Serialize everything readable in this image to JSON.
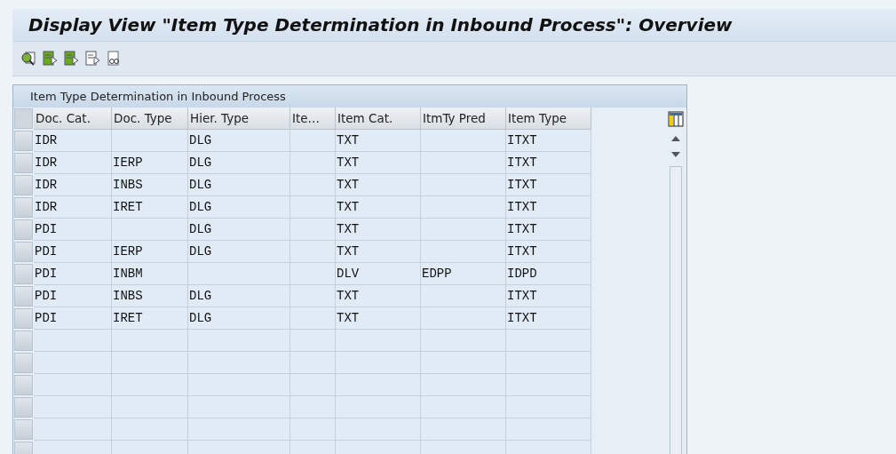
{
  "window": {
    "title": "Display View \"Item Type Determination in Inbound Process\": Overview"
  },
  "toolbar": {
    "buttons": [
      {
        "kind": "find"
      },
      {
        "kind": "green"
      },
      {
        "kind": "green"
      },
      {
        "kind": "plain"
      },
      {
        "kind": "glasses"
      }
    ]
  },
  "table": {
    "title": "Item Type Determination in Inbound Process",
    "columns": [
      "Doc. Cat.",
      "Doc. Type",
      "Hier. Type",
      "Ite…",
      "Item Cat.",
      "ItmTy Pred",
      "Item Type"
    ],
    "rows": [
      [
        "IDR",
        "",
        "DLG",
        "",
        "TXT",
        "",
        "ITXT"
      ],
      [
        "IDR",
        "IERP",
        "DLG",
        "",
        "TXT",
        "",
        "ITXT"
      ],
      [
        "IDR",
        "INBS",
        "DLG",
        "",
        "TXT",
        "",
        "ITXT"
      ],
      [
        "IDR",
        "IRET",
        "DLG",
        "",
        "TXT",
        "",
        "ITXT"
      ],
      [
        "PDI",
        "",
        "DLG",
        "",
        "TXT",
        "",
        "ITXT"
      ],
      [
        "PDI",
        "IERP",
        "DLG",
        "",
        "TXT",
        "",
        "ITXT"
      ],
      [
        "PDI",
        "INBM",
        "",
        "",
        "DLV",
        "EDPP",
        "IDPD"
      ],
      [
        "PDI",
        "INBS",
        "DLG",
        "",
        "TXT",
        "",
        "ITXT"
      ],
      [
        "PDI",
        "IRET",
        "DLG",
        "",
        "TXT",
        "",
        "ITXT"
      ]
    ]
  }
}
